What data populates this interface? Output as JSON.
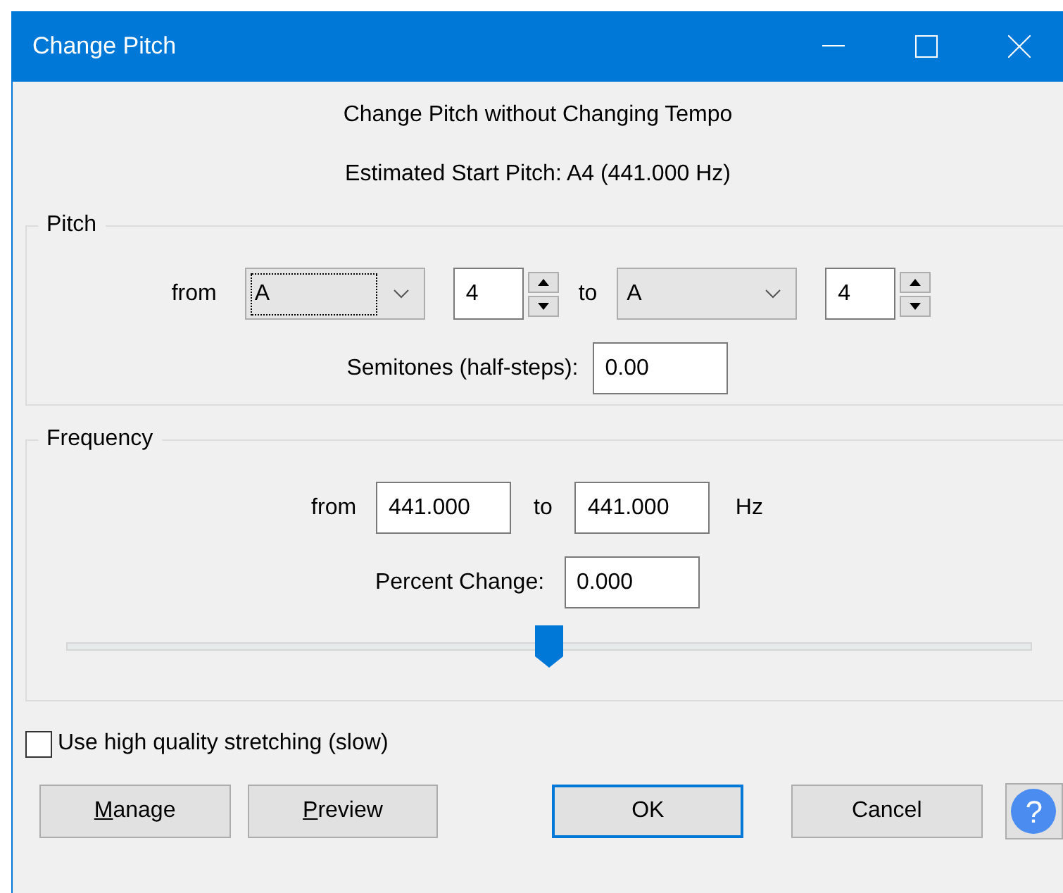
{
  "window": {
    "title": "Change Pitch"
  },
  "heading": "Change Pitch without Changing Tempo",
  "estimate": "Estimated Start Pitch: A4 (441.000 Hz)",
  "pitch": {
    "title": "Pitch",
    "from_label": "from",
    "from_note": "A",
    "from_octave": "4",
    "to_label": "to",
    "to_note": "A",
    "to_octave": "4",
    "semitones_label": "Semitones (half-steps):",
    "semitones": "0.00"
  },
  "frequency": {
    "title": "Frequency",
    "from_label": "from",
    "from": "441.000",
    "to_label": "to",
    "to": "441.000",
    "unit": "Hz",
    "percent_label": "Percent Change:",
    "percent": "0.000",
    "slider": {
      "level": 0.5
    }
  },
  "high_quality": {
    "label": "Use high quality stretching (slow)",
    "checked": false
  },
  "buttons": [
    {
      "accel": "M",
      "rest": "anage",
      "default": false
    },
    {
      "accel": "P",
      "rest": "review",
      "default": false
    },
    {
      "rest": "OK",
      "default": true
    },
    {
      "rest": "Cancel",
      "default": false
    }
  ],
  "help": "?"
}
